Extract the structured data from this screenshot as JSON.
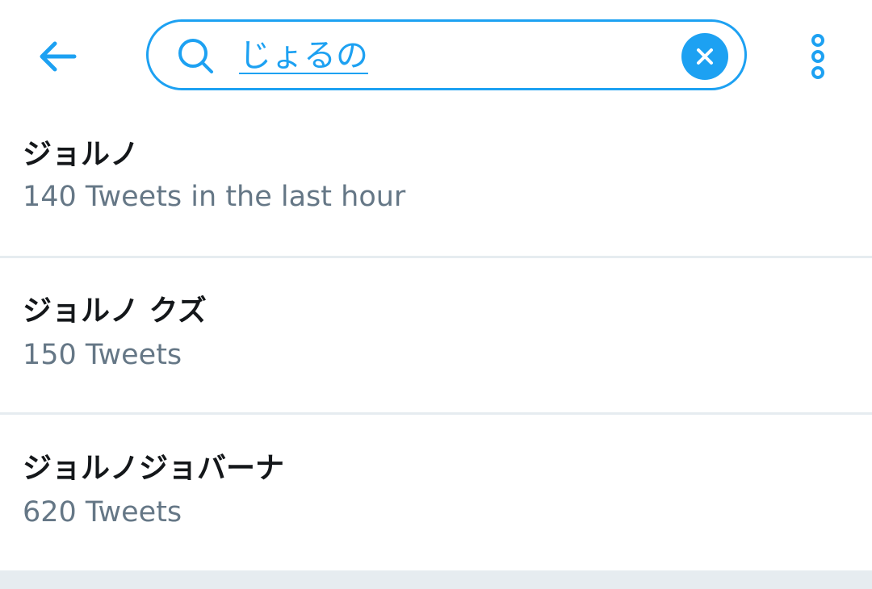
{
  "colors": {
    "accent": "#1da1f2",
    "title": "#14171a",
    "subtitle": "#657786",
    "divider": "#e6ecf0"
  },
  "header": {
    "back_icon": "arrow-left-icon",
    "search": {
      "icon": "search-icon",
      "query": "じょるの",
      "clear_icon": "close-icon"
    },
    "overflow_icon": "vertical-dots-icon"
  },
  "results": [
    {
      "title": "ジョルノ",
      "subtitle": "140 Tweets in the last hour"
    },
    {
      "title": "ジョルノ クズ",
      "subtitle": "150 Tweets"
    },
    {
      "title": "ジョルノジョバーナ",
      "subtitle": "620 Tweets"
    }
  ]
}
